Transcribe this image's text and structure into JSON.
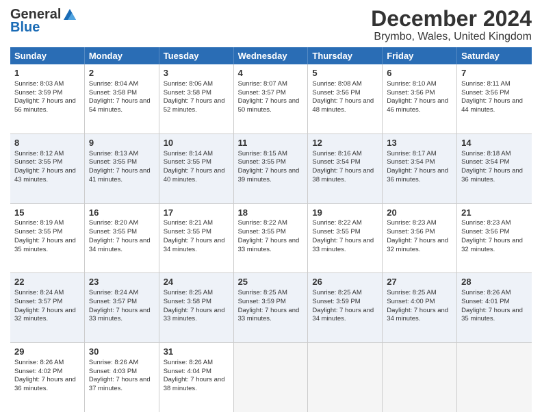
{
  "logo": {
    "general": "General",
    "blue": "Blue"
  },
  "title": "December 2024",
  "location": "Brymbo, Wales, United Kingdom",
  "days_of_week": [
    "Sunday",
    "Monday",
    "Tuesday",
    "Wednesday",
    "Thursday",
    "Friday",
    "Saturday"
  ],
  "weeks": [
    [
      {
        "day": "1",
        "sunrise": "Sunrise: 8:03 AM",
        "sunset": "Sunset: 3:59 PM",
        "daylight": "Daylight: 7 hours and 56 minutes."
      },
      {
        "day": "2",
        "sunrise": "Sunrise: 8:04 AM",
        "sunset": "Sunset: 3:58 PM",
        "daylight": "Daylight: 7 hours and 54 minutes."
      },
      {
        "day": "3",
        "sunrise": "Sunrise: 8:06 AM",
        "sunset": "Sunset: 3:58 PM",
        "daylight": "Daylight: 7 hours and 52 minutes."
      },
      {
        "day": "4",
        "sunrise": "Sunrise: 8:07 AM",
        "sunset": "Sunset: 3:57 PM",
        "daylight": "Daylight: 7 hours and 50 minutes."
      },
      {
        "day": "5",
        "sunrise": "Sunrise: 8:08 AM",
        "sunset": "Sunset: 3:56 PM",
        "daylight": "Daylight: 7 hours and 48 minutes."
      },
      {
        "day": "6",
        "sunrise": "Sunrise: 8:10 AM",
        "sunset": "Sunset: 3:56 PM",
        "daylight": "Daylight: 7 hours and 46 minutes."
      },
      {
        "day": "7",
        "sunrise": "Sunrise: 8:11 AM",
        "sunset": "Sunset: 3:56 PM",
        "daylight": "Daylight: 7 hours and 44 minutes."
      }
    ],
    [
      {
        "day": "8",
        "sunrise": "Sunrise: 8:12 AM",
        "sunset": "Sunset: 3:55 PM",
        "daylight": "Daylight: 7 hours and 43 minutes."
      },
      {
        "day": "9",
        "sunrise": "Sunrise: 8:13 AM",
        "sunset": "Sunset: 3:55 PM",
        "daylight": "Daylight: 7 hours and 41 minutes."
      },
      {
        "day": "10",
        "sunrise": "Sunrise: 8:14 AM",
        "sunset": "Sunset: 3:55 PM",
        "daylight": "Daylight: 7 hours and 40 minutes."
      },
      {
        "day": "11",
        "sunrise": "Sunrise: 8:15 AM",
        "sunset": "Sunset: 3:55 PM",
        "daylight": "Daylight: 7 hours and 39 minutes."
      },
      {
        "day": "12",
        "sunrise": "Sunrise: 8:16 AM",
        "sunset": "Sunset: 3:54 PM",
        "daylight": "Daylight: 7 hours and 38 minutes."
      },
      {
        "day": "13",
        "sunrise": "Sunrise: 8:17 AM",
        "sunset": "Sunset: 3:54 PM",
        "daylight": "Daylight: 7 hours and 36 minutes."
      },
      {
        "day": "14",
        "sunrise": "Sunrise: 8:18 AM",
        "sunset": "Sunset: 3:54 PM",
        "daylight": "Daylight: 7 hours and 36 minutes."
      }
    ],
    [
      {
        "day": "15",
        "sunrise": "Sunrise: 8:19 AM",
        "sunset": "Sunset: 3:55 PM",
        "daylight": "Daylight: 7 hours and 35 minutes."
      },
      {
        "day": "16",
        "sunrise": "Sunrise: 8:20 AM",
        "sunset": "Sunset: 3:55 PM",
        "daylight": "Daylight: 7 hours and 34 minutes."
      },
      {
        "day": "17",
        "sunrise": "Sunrise: 8:21 AM",
        "sunset": "Sunset: 3:55 PM",
        "daylight": "Daylight: 7 hours and 34 minutes."
      },
      {
        "day": "18",
        "sunrise": "Sunrise: 8:22 AM",
        "sunset": "Sunset: 3:55 PM",
        "daylight": "Daylight: 7 hours and 33 minutes."
      },
      {
        "day": "19",
        "sunrise": "Sunrise: 8:22 AM",
        "sunset": "Sunset: 3:55 PM",
        "daylight": "Daylight: 7 hours and 33 minutes."
      },
      {
        "day": "20",
        "sunrise": "Sunrise: 8:23 AM",
        "sunset": "Sunset: 3:56 PM",
        "daylight": "Daylight: 7 hours and 32 minutes."
      },
      {
        "day": "21",
        "sunrise": "Sunrise: 8:23 AM",
        "sunset": "Sunset: 3:56 PM",
        "daylight": "Daylight: 7 hours and 32 minutes."
      }
    ],
    [
      {
        "day": "22",
        "sunrise": "Sunrise: 8:24 AM",
        "sunset": "Sunset: 3:57 PM",
        "daylight": "Daylight: 7 hours and 32 minutes."
      },
      {
        "day": "23",
        "sunrise": "Sunrise: 8:24 AM",
        "sunset": "Sunset: 3:57 PM",
        "daylight": "Daylight: 7 hours and 33 minutes."
      },
      {
        "day": "24",
        "sunrise": "Sunrise: 8:25 AM",
        "sunset": "Sunset: 3:58 PM",
        "daylight": "Daylight: 7 hours and 33 minutes."
      },
      {
        "day": "25",
        "sunrise": "Sunrise: 8:25 AM",
        "sunset": "Sunset: 3:59 PM",
        "daylight": "Daylight: 7 hours and 33 minutes."
      },
      {
        "day": "26",
        "sunrise": "Sunrise: 8:25 AM",
        "sunset": "Sunset: 3:59 PM",
        "daylight": "Daylight: 7 hours and 34 minutes."
      },
      {
        "day": "27",
        "sunrise": "Sunrise: 8:25 AM",
        "sunset": "Sunset: 4:00 PM",
        "daylight": "Daylight: 7 hours and 34 minutes."
      },
      {
        "day": "28",
        "sunrise": "Sunrise: 8:26 AM",
        "sunset": "Sunset: 4:01 PM",
        "daylight": "Daylight: 7 hours and 35 minutes."
      }
    ],
    [
      {
        "day": "29",
        "sunrise": "Sunrise: 8:26 AM",
        "sunset": "Sunset: 4:02 PM",
        "daylight": "Daylight: 7 hours and 36 minutes."
      },
      {
        "day": "30",
        "sunrise": "Sunrise: 8:26 AM",
        "sunset": "Sunset: 4:03 PM",
        "daylight": "Daylight: 7 hours and 37 minutes."
      },
      {
        "day": "31",
        "sunrise": "Sunrise: 8:26 AM",
        "sunset": "Sunset: 4:04 PM",
        "daylight": "Daylight: 7 hours and 38 minutes."
      },
      {
        "day": "",
        "sunrise": "",
        "sunset": "",
        "daylight": ""
      },
      {
        "day": "",
        "sunrise": "",
        "sunset": "",
        "daylight": ""
      },
      {
        "day": "",
        "sunrise": "",
        "sunset": "",
        "daylight": ""
      },
      {
        "day": "",
        "sunrise": "",
        "sunset": "",
        "daylight": ""
      }
    ]
  ]
}
